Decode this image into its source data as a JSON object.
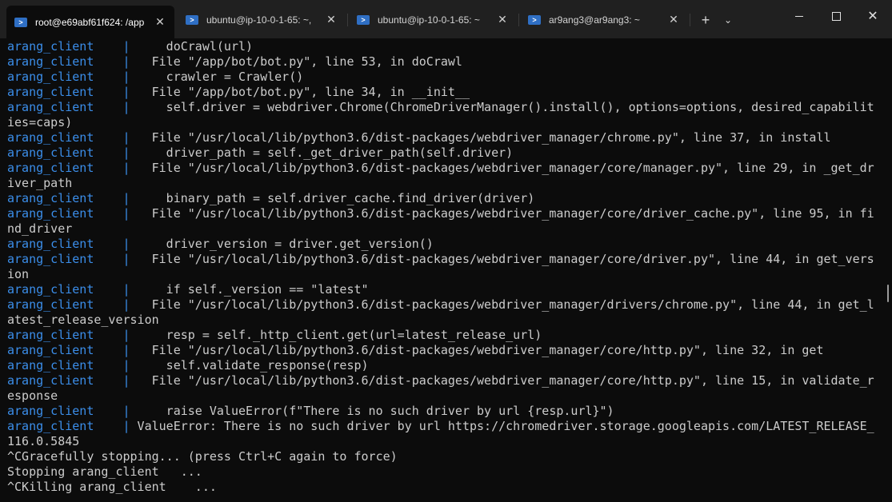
{
  "tabs": [
    {
      "title": "root@e69abf61f624: /app",
      "active": true
    },
    {
      "title": "ubuntu@ip-10-0-1-65: ~,",
      "active": false
    },
    {
      "title": "ubuntu@ip-10-0-1-65: ~",
      "active": false
    },
    {
      "title": "ar9ang3@ar9ang3: ~",
      "active": false
    }
  ],
  "tab_icon_glyph": ">",
  "tab_close_glyph": "✕",
  "new_tab_glyph": "+",
  "dropdown_glyph": "⌄",
  "window_controls": {
    "close_glyph": "✕"
  },
  "colors": {
    "service": "#3b8eea",
    "text": "#cccccc",
    "background": "#0c0c0c",
    "titlebar": "#202020"
  },
  "terminal": {
    "lines": [
      {
        "svc": "arang_client    |",
        "text": "     doCrawl(url)"
      },
      {
        "svc": "arang_client    |",
        "text": "   File \"/app/bot/bot.py\", line 53, in doCrawl"
      },
      {
        "svc": "arang_client    |",
        "text": "     crawler = Crawler()"
      },
      {
        "svc": "arang_client    |",
        "text": "   File \"/app/bot/bot.py\", line 34, in __init__"
      },
      {
        "svc": "arang_client    |",
        "text": "     self.driver = webdriver.Chrome(ChromeDriverManager().install(), options=options, desired_capabilit"
      },
      {
        "svc": "",
        "text": "ies=caps)"
      },
      {
        "svc": "arang_client    |",
        "text": "   File \"/usr/local/lib/python3.6/dist-packages/webdriver_manager/chrome.py\", line 37, in install"
      },
      {
        "svc": "arang_client    |",
        "text": "     driver_path = self._get_driver_path(self.driver)"
      },
      {
        "svc": "arang_client    |",
        "text": "   File \"/usr/local/lib/python3.6/dist-packages/webdriver_manager/core/manager.py\", line 29, in _get_dr"
      },
      {
        "svc": "",
        "text": "iver_path"
      },
      {
        "svc": "arang_client    |",
        "text": "     binary_path = self.driver_cache.find_driver(driver)"
      },
      {
        "svc": "arang_client    |",
        "text": "   File \"/usr/local/lib/python3.6/dist-packages/webdriver_manager/core/driver_cache.py\", line 95, in fi"
      },
      {
        "svc": "",
        "text": "nd_driver"
      },
      {
        "svc": "arang_client    |",
        "text": "     driver_version = driver.get_version()"
      },
      {
        "svc": "arang_client    |",
        "text": "   File \"/usr/local/lib/python3.6/dist-packages/webdriver_manager/core/driver.py\", line 44, in get_vers"
      },
      {
        "svc": "",
        "text": "ion"
      },
      {
        "svc": "arang_client    |",
        "text": "     if self._version == \"latest\""
      },
      {
        "svc": "arang_client    |",
        "text": "   File \"/usr/local/lib/python3.6/dist-packages/webdriver_manager/drivers/chrome.py\", line 44, in get_l"
      },
      {
        "svc": "",
        "text": "atest_release_version"
      },
      {
        "svc": "arang_client    |",
        "text": "     resp = self._http_client.get(url=latest_release_url)"
      },
      {
        "svc": "arang_client    |",
        "text": "   File \"/usr/local/lib/python3.6/dist-packages/webdriver_manager/core/http.py\", line 32, in get"
      },
      {
        "svc": "arang_client    |",
        "text": "     self.validate_response(resp)"
      },
      {
        "svc": "arang_client    |",
        "text": "   File \"/usr/local/lib/python3.6/dist-packages/webdriver_manager/core/http.py\", line 15, in validate_r"
      },
      {
        "svc": "",
        "text": "esponse"
      },
      {
        "svc": "arang_client    |",
        "text": "     raise ValueError(f\"There is no such driver by url {resp.url}\")"
      },
      {
        "svc": "arang_client    |",
        "text": " ValueError: There is no such driver by url https://chromedriver.storage.googleapis.com/LATEST_RELEASE_"
      },
      {
        "svc": "",
        "text": "116.0.5845"
      },
      {
        "svc": "",
        "text": "^CGracefully stopping... (press Ctrl+C again to force)"
      },
      {
        "svc": "",
        "text": "Stopping arang_client   ..."
      },
      {
        "svc": "",
        "text": "^CKilling arang_client    ..."
      }
    ]
  }
}
